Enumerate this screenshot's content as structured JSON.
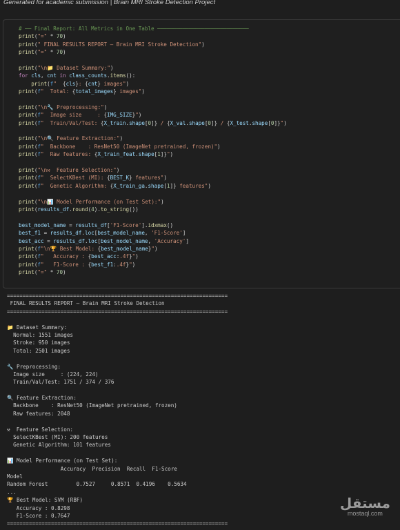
{
  "header": {
    "caption": "Generated for academic submission | Brain MRI Stroke Detection Project"
  },
  "code": [
    [
      [
        "c",
        "# ── Final Report: All Metrics in One Table ─────────────────────────────"
      ]
    ],
    [
      [
        "f",
        "print"
      ],
      [
        "p",
        "("
      ],
      [
        "s",
        "\"=\""
      ],
      [
        "p",
        " * "
      ],
      [
        "n",
        "70"
      ],
      [
        "p",
        ")"
      ]
    ],
    [
      [
        "f",
        "print"
      ],
      [
        "p",
        "("
      ],
      [
        "s",
        "\" FINAL RESULTS REPORT — Brain MRI Stroke Detection\""
      ],
      [
        "p",
        ")"
      ]
    ],
    [
      [
        "f",
        "print"
      ],
      [
        "p",
        "("
      ],
      [
        "s",
        "\"=\""
      ],
      [
        "p",
        " * "
      ],
      [
        "n",
        "70"
      ],
      [
        "p",
        ")"
      ]
    ],
    [],
    [
      [
        "f",
        "print"
      ],
      [
        "p",
        "("
      ],
      [
        "s",
        "\"\\n📁 Dataset Summary:\""
      ],
      [
        "p",
        ")"
      ]
    ],
    [
      [
        "k",
        "for"
      ],
      [
        "p",
        " "
      ],
      [
        "v",
        "cls"
      ],
      [
        "p",
        ", "
      ],
      [
        "v",
        "cnt"
      ],
      [
        "p",
        " "
      ],
      [
        "k",
        "in"
      ],
      [
        "p",
        " "
      ],
      [
        "v",
        "class_counts"
      ],
      [
        "p",
        "."
      ],
      [
        "f",
        "items"
      ],
      [
        "p",
        "():"
      ]
    ],
    [
      [
        "p",
        "    "
      ],
      [
        "f",
        "print"
      ],
      [
        "p",
        "("
      ],
      [
        "b",
        "f"
      ],
      [
        "s",
        "\"  "
      ],
      [
        "p",
        "{"
      ],
      [
        "v",
        "cls"
      ],
      [
        "p",
        "}"
      ],
      [
        "s",
        ": "
      ],
      [
        "p",
        "{"
      ],
      [
        "v",
        "cnt"
      ],
      [
        "p",
        "}"
      ],
      [
        "s",
        " images\""
      ],
      [
        "p",
        ")"
      ]
    ],
    [
      [
        "f",
        "print"
      ],
      [
        "p",
        "("
      ],
      [
        "b",
        "f"
      ],
      [
        "s",
        "\"  Total: "
      ],
      [
        "p",
        "{"
      ],
      [
        "v",
        "total_images"
      ],
      [
        "p",
        "}"
      ],
      [
        "s",
        " images\""
      ],
      [
        "p",
        ")"
      ]
    ],
    [],
    [
      [
        "f",
        "print"
      ],
      [
        "p",
        "("
      ],
      [
        "s",
        "\"\\n🔧 Preprocessing:\""
      ],
      [
        "p",
        ")"
      ]
    ],
    [
      [
        "f",
        "print"
      ],
      [
        "p",
        "("
      ],
      [
        "b",
        "f"
      ],
      [
        "s",
        "\"  Image size     : "
      ],
      [
        "p",
        "{"
      ],
      [
        "v",
        "IMG_SIZE"
      ],
      [
        "p",
        "}"
      ],
      [
        "s",
        "\""
      ],
      [
        "p",
        ")"
      ]
    ],
    [
      [
        "f",
        "print"
      ],
      [
        "p",
        "("
      ],
      [
        "b",
        "f"
      ],
      [
        "s",
        "\"  Train/Val/Test: "
      ],
      [
        "p",
        "{"
      ],
      [
        "v",
        "X_train"
      ],
      [
        "p",
        "."
      ],
      [
        "v",
        "shape"
      ],
      [
        "p",
        "["
      ],
      [
        "n",
        "0"
      ],
      [
        "p",
        "]}"
      ],
      [
        "s",
        " / "
      ],
      [
        "p",
        "{"
      ],
      [
        "v",
        "X_val"
      ],
      [
        "p",
        "."
      ],
      [
        "v",
        "shape"
      ],
      [
        "p",
        "["
      ],
      [
        "n",
        "0"
      ],
      [
        "p",
        "]}"
      ],
      [
        "s",
        " / "
      ],
      [
        "p",
        "{"
      ],
      [
        "v",
        "X_test"
      ],
      [
        "p",
        "."
      ],
      [
        "v",
        "shape"
      ],
      [
        "p",
        "["
      ],
      [
        "n",
        "0"
      ],
      [
        "p",
        "]}"
      ],
      [
        "s",
        "\""
      ],
      [
        "p",
        ")"
      ]
    ],
    [],
    [
      [
        "f",
        "print"
      ],
      [
        "p",
        "("
      ],
      [
        "s",
        "\"\\n🔍 Feature Extraction:\""
      ],
      [
        "p",
        ")"
      ]
    ],
    [
      [
        "f",
        "print"
      ],
      [
        "p",
        "("
      ],
      [
        "b",
        "f"
      ],
      [
        "s",
        "\"  Backbone    : ResNet50 (ImageNet pretrained, frozen)\""
      ],
      [
        "p",
        ")"
      ]
    ],
    [
      [
        "f",
        "print"
      ],
      [
        "p",
        "("
      ],
      [
        "b",
        "f"
      ],
      [
        "s",
        "\"  Raw features: "
      ],
      [
        "p",
        "{"
      ],
      [
        "v",
        "X_train_feat"
      ],
      [
        "p",
        "."
      ],
      [
        "v",
        "shape"
      ],
      [
        "p",
        "["
      ],
      [
        "n",
        "1"
      ],
      [
        "p",
        "]}"
      ],
      [
        "s",
        "\""
      ],
      [
        "p",
        ")"
      ]
    ],
    [],
    [
      [
        "f",
        "print"
      ],
      [
        "p",
        "("
      ],
      [
        "s",
        "\"\\n⚒  Feature Selection:\""
      ],
      [
        "p",
        ")"
      ]
    ],
    [
      [
        "f",
        "print"
      ],
      [
        "p",
        "("
      ],
      [
        "b",
        "f"
      ],
      [
        "s",
        "\"  SelectKBest (MI): "
      ],
      [
        "p",
        "{"
      ],
      [
        "v",
        "BEST_K"
      ],
      [
        "p",
        "}"
      ],
      [
        "s",
        " features\""
      ],
      [
        "p",
        ")"
      ]
    ],
    [
      [
        "f",
        "print"
      ],
      [
        "p",
        "("
      ],
      [
        "b",
        "f"
      ],
      [
        "s",
        "\"  Genetic Algorithm: "
      ],
      [
        "p",
        "{"
      ],
      [
        "v",
        "X_train_ga"
      ],
      [
        "p",
        "."
      ],
      [
        "v",
        "shape"
      ],
      [
        "p",
        "["
      ],
      [
        "n",
        "1"
      ],
      [
        "p",
        "]}"
      ],
      [
        "s",
        " features\""
      ],
      [
        "p",
        ")"
      ]
    ],
    [],
    [
      [
        "f",
        "print"
      ],
      [
        "p",
        "("
      ],
      [
        "s",
        "\"\\n📊 Model Performance (on Test Set):\""
      ],
      [
        "p",
        ")"
      ]
    ],
    [
      [
        "f",
        "print"
      ],
      [
        "p",
        "("
      ],
      [
        "v",
        "results_df"
      ],
      [
        "p",
        "."
      ],
      [
        "f",
        "round"
      ],
      [
        "p",
        "("
      ],
      [
        "n",
        "4"
      ],
      [
        "p",
        ")."
      ],
      [
        "f",
        "to_string"
      ],
      [
        "p",
        "())"
      ]
    ],
    [],
    [
      [
        "v",
        "best_model_name"
      ],
      [
        "p",
        " = "
      ],
      [
        "v",
        "results_df"
      ],
      [
        "p",
        "["
      ],
      [
        "s",
        "'F1-Score'"
      ],
      [
        "p",
        "]."
      ],
      [
        "f",
        "idxmax"
      ],
      [
        "p",
        "()"
      ]
    ],
    [
      [
        "v",
        "best_f1"
      ],
      [
        "p",
        " = "
      ],
      [
        "v",
        "results_df"
      ],
      [
        "p",
        "."
      ],
      [
        "v",
        "loc"
      ],
      [
        "p",
        "["
      ],
      [
        "v",
        "best_model_name"
      ],
      [
        "p",
        ", "
      ],
      [
        "s",
        "'F1-Score'"
      ],
      [
        "p",
        "]"
      ]
    ],
    [
      [
        "v",
        "best_acc"
      ],
      [
        "p",
        " = "
      ],
      [
        "v",
        "results_df"
      ],
      [
        "p",
        "."
      ],
      [
        "v",
        "loc"
      ],
      [
        "p",
        "["
      ],
      [
        "v",
        "best_model_name"
      ],
      [
        "p",
        ", "
      ],
      [
        "s",
        "'Accuracy'"
      ],
      [
        "p",
        "]"
      ]
    ],
    [
      [
        "f",
        "print"
      ],
      [
        "p",
        "("
      ],
      [
        "b",
        "f"
      ],
      [
        "s",
        "\"\\n🏆 Best Model: "
      ],
      [
        "p",
        "{"
      ],
      [
        "v",
        "best_model_name"
      ],
      [
        "p",
        "}"
      ],
      [
        "s",
        "\""
      ],
      [
        "p",
        ")"
      ]
    ],
    [
      [
        "f",
        "print"
      ],
      [
        "p",
        "("
      ],
      [
        "b",
        "f"
      ],
      [
        "s",
        "\"   Accuracy : "
      ],
      [
        "p",
        "{"
      ],
      [
        "v",
        "best_acc"
      ],
      [
        "p",
        ":"
      ],
      [
        "s",
        ".4f"
      ],
      [
        "p",
        "}"
      ],
      [
        "s",
        "\""
      ],
      [
        "p",
        ")"
      ]
    ],
    [
      [
        "f",
        "print"
      ],
      [
        "p",
        "("
      ],
      [
        "b",
        "f"
      ],
      [
        "s",
        "\"   F1-Score : "
      ],
      [
        "p",
        "{"
      ],
      [
        "v",
        "best_f1"
      ],
      [
        "p",
        ":"
      ],
      [
        "s",
        ".4f"
      ],
      [
        "p",
        "}"
      ],
      [
        "s",
        "\""
      ],
      [
        "p",
        ")"
      ]
    ],
    [
      [
        "f",
        "print"
      ],
      [
        "p",
        "("
      ],
      [
        "s",
        "\"=\""
      ],
      [
        "p",
        " * "
      ],
      [
        "n",
        "70"
      ],
      [
        "p",
        ")"
      ]
    ]
  ],
  "output": [
    "======================================================================",
    " FINAL RESULTS REPORT — Brain MRI Stroke Detection",
    "======================================================================",
    "",
    "📁 Dataset Summary:",
    "  Normal: 1551 images",
    "  Stroke: 950 images",
    "  Total: 2501 images",
    "",
    "🔧 Preprocessing:",
    "  Image size     : (224, 224)",
    "  Train/Val/Test: 1751 / 374 / 376",
    "",
    "🔍 Feature Extraction:",
    "  Backbone    : ResNet50 (ImageNet pretrained, frozen)",
    "  Raw features: 2048",
    "",
    "⚒  Feature Selection:",
    "  SelectKBest (MI): 200 features",
    "  Genetic Algorithm: 101 features",
    "",
    "📊 Model Performance (on Test Set):",
    "                 Accuracy  Precision  Recall  F1-Score",
    "Model",
    "Random Forest         0.7527     0.8571  0.4196    0.5634",
    "...",
    "🏆 Best Model: SVM (RBF)",
    "   Accuracy : 0.8298",
    "   F1-Score : 0.7647",
    "======================================================================"
  ],
  "watermark": {
    "arabic": "مستقل",
    "latin": "mostaql.com"
  }
}
